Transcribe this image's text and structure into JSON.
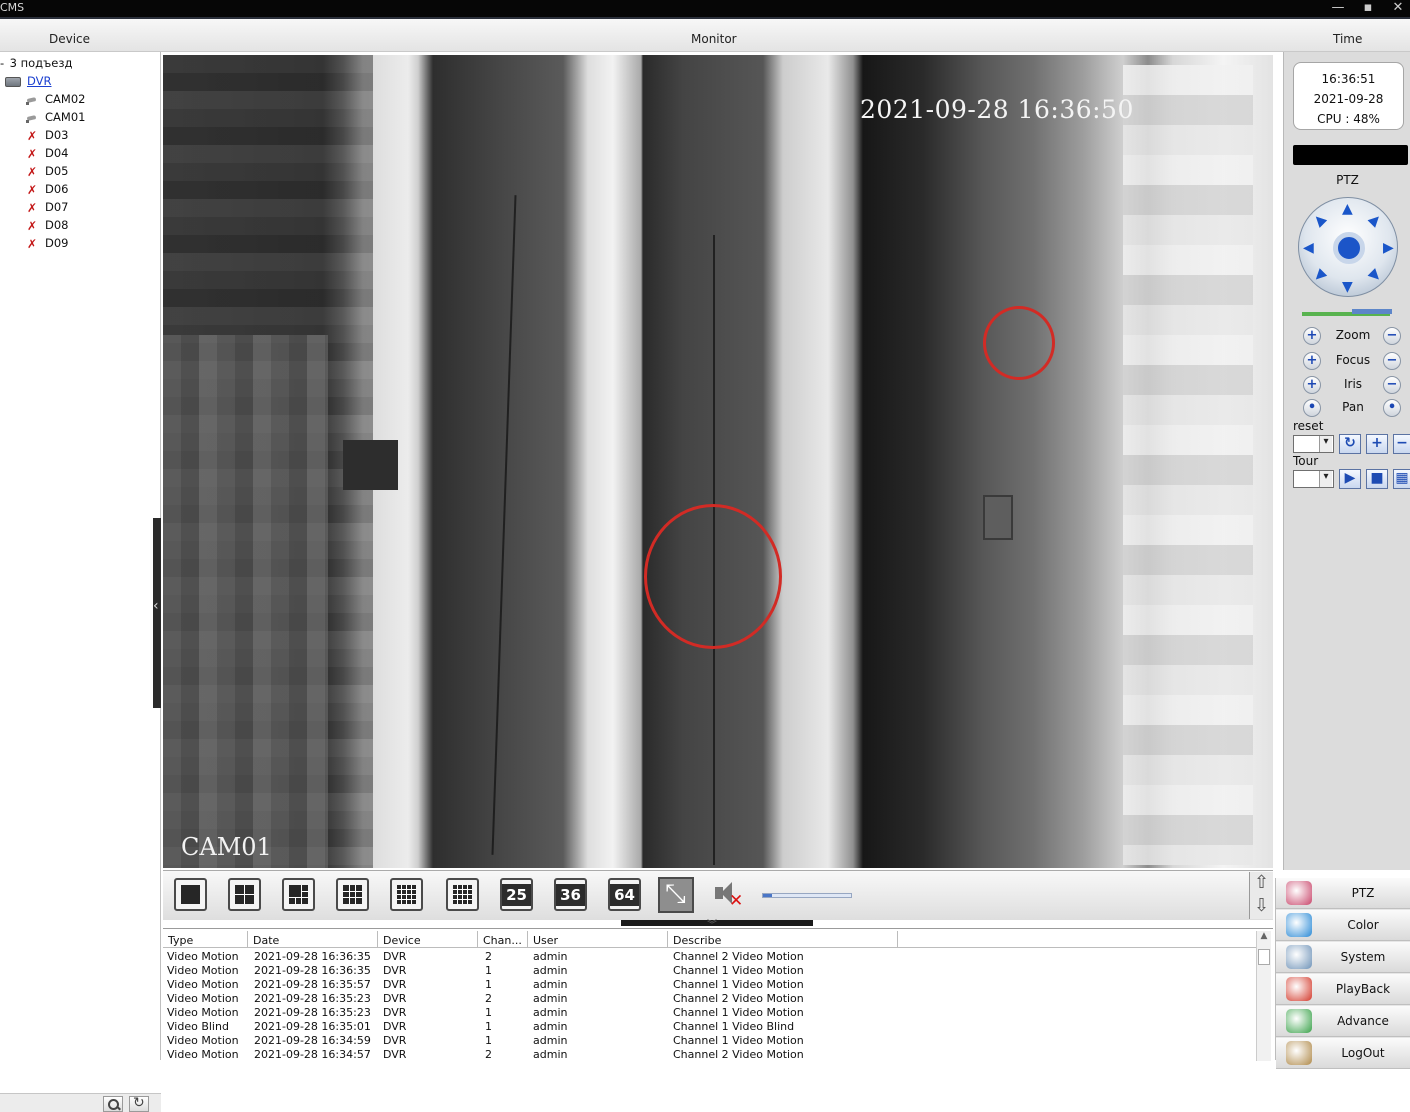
{
  "window": {
    "title": "CMS"
  },
  "header": {
    "device": "Device",
    "monitor": "Monitor",
    "time": "Time"
  },
  "tree": {
    "group": "3 подъезд",
    "dvr": "DVR",
    "channels": [
      {
        "label": "CAM02",
        "status": "online"
      },
      {
        "label": "CAM01",
        "status": "online"
      },
      {
        "label": "D03",
        "status": "offline"
      },
      {
        "label": "D04",
        "status": "offline"
      },
      {
        "label": "D05",
        "status": "offline"
      },
      {
        "label": "D06",
        "status": "offline"
      },
      {
        "label": "D07",
        "status": "offline"
      },
      {
        "label": "D08",
        "status": "offline"
      },
      {
        "label": "D09",
        "status": "offline"
      }
    ]
  },
  "video": {
    "timestamp": "2021-09-28  16:36:50",
    "camera": "CAM01"
  },
  "clock": {
    "time": "16:36:51",
    "date": "2021-09-28",
    "cpu": "CPU : 48%"
  },
  "ptz": {
    "title": "PTZ",
    "controls": [
      "Zoom",
      "Focus",
      "Iris",
      "Pan"
    ],
    "preset_label": "reset",
    "tour_label": "Tour"
  },
  "toolbar": {
    "layouts": [
      "1",
      "4",
      "6",
      "9",
      "8",
      "16",
      "25",
      "36",
      "64"
    ],
    "volume": 0.1
  },
  "log": {
    "columns": [
      "Type",
      "Date",
      "Device",
      "Chan...",
      "User",
      "Describe"
    ],
    "rows": [
      [
        "Video Motion",
        "2021-09-28 16:36:35",
        "DVR",
        "2",
        "admin",
        "Channel 2 Video Motion"
      ],
      [
        "Video Motion",
        "2021-09-28 16:36:35",
        "DVR",
        "1",
        "admin",
        "Channel 1 Video Motion"
      ],
      [
        "Video Motion",
        "2021-09-28 16:35:57",
        "DVR",
        "1",
        "admin",
        "Channel 1 Video Motion"
      ],
      [
        "Video Motion",
        "2021-09-28 16:35:23",
        "DVR",
        "2",
        "admin",
        "Channel 2 Video Motion"
      ],
      [
        "Video Motion",
        "2021-09-28 16:35:23",
        "DVR",
        "1",
        "admin",
        "Channel 1 Video Motion"
      ],
      [
        "Video Blind",
        "2021-09-28 16:35:01",
        "DVR",
        "1",
        "admin",
        "Channel 1 Video Blind"
      ],
      [
        "Video Motion",
        "2021-09-28 16:34:59",
        "DVR",
        "1",
        "admin",
        "Channel 1 Video Motion"
      ],
      [
        "Video Motion",
        "2021-09-28 16:34:57",
        "DVR",
        "2",
        "admin",
        "Channel 2 Video Motion"
      ]
    ]
  },
  "menu": [
    {
      "label": "PTZ",
      "icon": "ptz-icon"
    },
    {
      "label": "Color",
      "icon": "color-icon"
    },
    {
      "label": "System",
      "icon": "system-icon"
    },
    {
      "label": "PlayBack",
      "icon": "playback-icon"
    },
    {
      "label": "Advance",
      "icon": "advance-icon"
    },
    {
      "label": "LogOut",
      "icon": "logout-icon"
    }
  ]
}
